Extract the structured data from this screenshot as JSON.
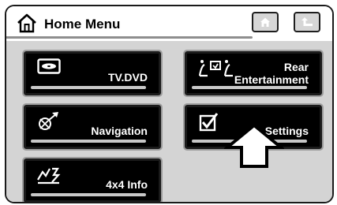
{
  "header": {
    "title": "Home Menu",
    "home_icon": "house-outline-icon",
    "home_button_icon": "house-icon",
    "back_button_icon": "return-arrow-icon"
  },
  "menu": {
    "items": [
      {
        "label": "TV.DVD",
        "icon": "dvd-disc-icon"
      },
      {
        "label": "Rear\nEntertainment",
        "icon": "rear-seat-screen-icon"
      },
      {
        "label": "Navigation",
        "icon": "navigation-compass-icon"
      },
      {
        "label": "Settings",
        "icon": "checkbox-tick-icon"
      },
      {
        "label": "4x4  Info",
        "icon": "mountain-terrain-icon"
      }
    ]
  },
  "annotation": {
    "icon": "upward-callout-arrow-icon"
  },
  "colors": {
    "tile_bg": "#000000",
    "tile_text": "#ffffff",
    "panel_bg": "#d4d4d4",
    "header_bg": "#ffffff"
  }
}
